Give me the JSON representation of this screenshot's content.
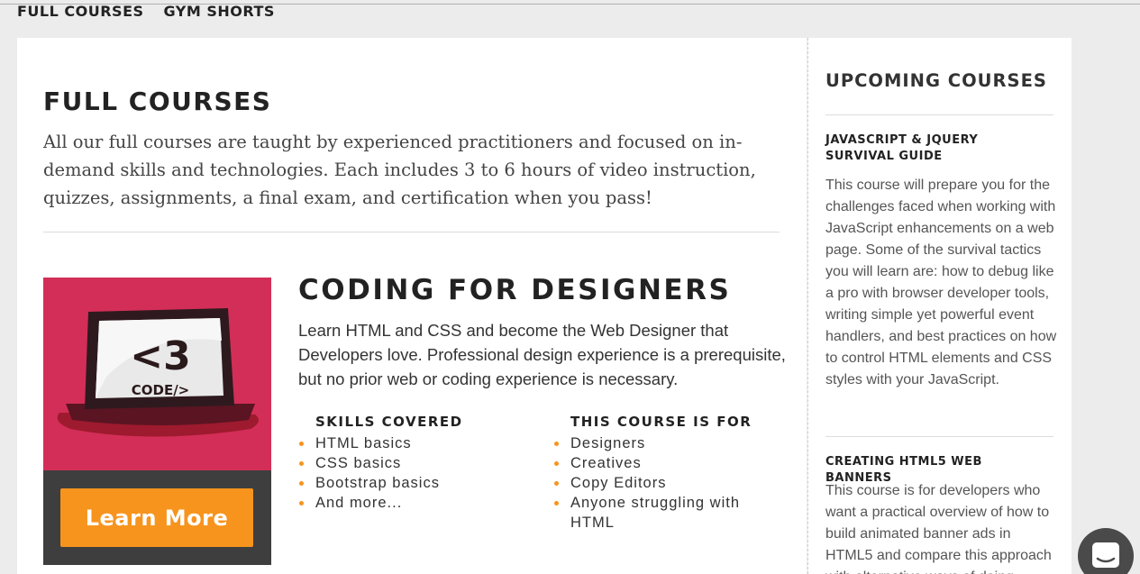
{
  "nav": {
    "items": [
      "FULL COURSES",
      "GYM SHORTS"
    ]
  },
  "main": {
    "title": "FULL COURSES",
    "intro": "All our full courses are taught by experienced practitioners and focused on in-demand skills and technologies. Each includes 3 to 6 hours of video instruction, quizzes, assignments, a final exam, and certification when you pass!"
  },
  "course": {
    "title": "CODING FOR DESIGNERS",
    "description": "Learn HTML and CSS and become the Web Designer that Developers love. Professional design experience is a prerequisite, but no prior web or coding experience is necessary.",
    "image_text_big": "<3",
    "image_text_small": "CODE/>",
    "button": "Learn More",
    "skills_heading": "SKILLS COVERED",
    "skills": [
      "HTML basics",
      "CSS basics",
      "Bootstrap basics",
      "And more..."
    ],
    "audience_heading": "THIS COURSE IS FOR",
    "audience": [
      "Designers",
      "Creatives",
      "Copy Editors",
      "Anyone struggling with HTML"
    ]
  },
  "sidebar": {
    "title": "UPCOMING COURSES",
    "courses": [
      {
        "title": "JAVASCRIPT & JQUERY SURVIVAL GUIDE",
        "description": "This course will prepare you for the challenges faced when working with JavaScript enhancements on a web page. Some of the survival tactics you will learn are: how to debug like a pro with browser developer tools, writing simple yet powerful event handlers, and best practices on how to control HTML elements and CSS styles with your JavaScript."
      },
      {
        "title": "CREATING HTML5 WEB BANNERS",
        "description": "This course is for developers who want a practical overview of how to build animated banner ads in HTML5 and compare this approach with alternative ways of doing"
      }
    ]
  },
  "colors": {
    "accent": "#f7941d",
    "image_bg": "#d32e57",
    "image_footer": "#3e3e3e"
  },
  "icons": {
    "chat": "chat-bubble-icon"
  }
}
